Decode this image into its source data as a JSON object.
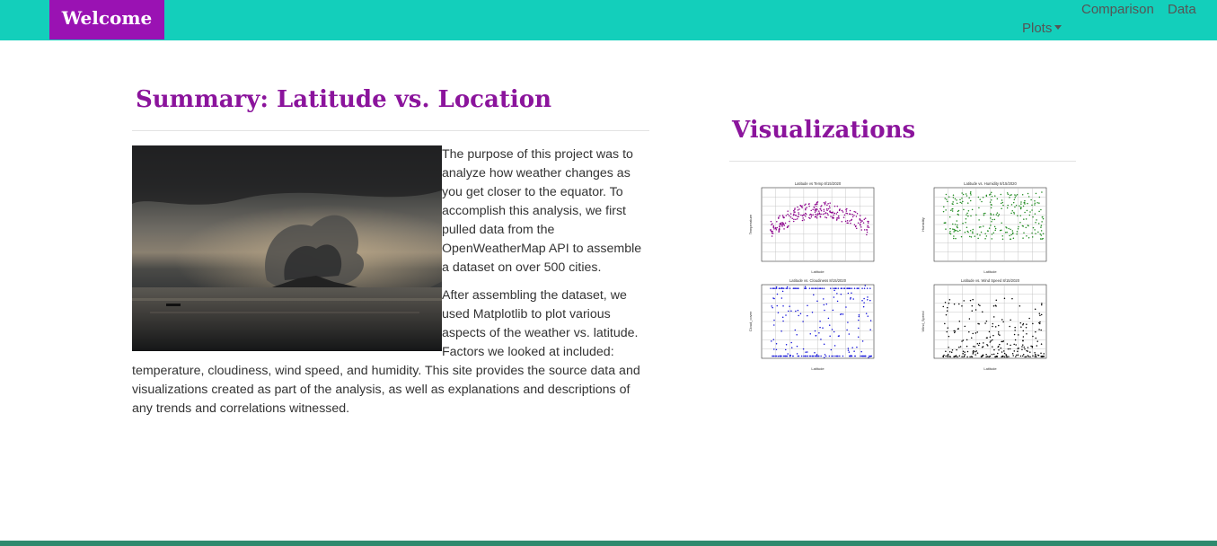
{
  "navbar": {
    "brand": "Welcome",
    "links": {
      "comparison": "Comparison",
      "data": "Data",
      "plots": "Plots"
    },
    "colors": {
      "bar": "#13cfbb",
      "brand": "#9a12b3"
    }
  },
  "summary": {
    "title": "Summary: Latitude vs. Location",
    "paragraph1": "The purpose of this project was to analyze how weather changes as you get closer to the equator. To accomplish this analysis, we first pulled data from the OpenWeatherMap API to assemble a dataset on over 500 cities.",
    "paragraph2": "After assembling the dataset, we used Matplotlib to plot various aspects of the weather vs. latitude. Factors we looked at included: temperature, cloudiness, wind speed, and humidity. This site provides the source data and visualizations created as part of the analysis, as well as explanations and descriptions of any trends and correlations witnessed."
  },
  "visualizations": {
    "title": "Visualizations",
    "plots": [
      {
        "title": "Latitude vs Temp 8/15/2020",
        "xlabel": "Latitude",
        "ylabel": "Temperature",
        "color": "#8b008b"
      },
      {
        "title": "Latitude vs. Humidity 8/15/2020",
        "xlabel": "Latitude",
        "ylabel": "Humidity",
        "color": "#1f8a1f"
      },
      {
        "title": "Latitude vs. Cloudiness 8/15/2020",
        "xlabel": "Latitude",
        "ylabel": "Cloud_cover",
        "color": "#1010d8"
      },
      {
        "title": "Latitude vs. Wind Speed 8/15/2020",
        "xlabel": "Latitude",
        "ylabel": "Wind_Speed",
        "color": "#000000"
      }
    ]
  }
}
